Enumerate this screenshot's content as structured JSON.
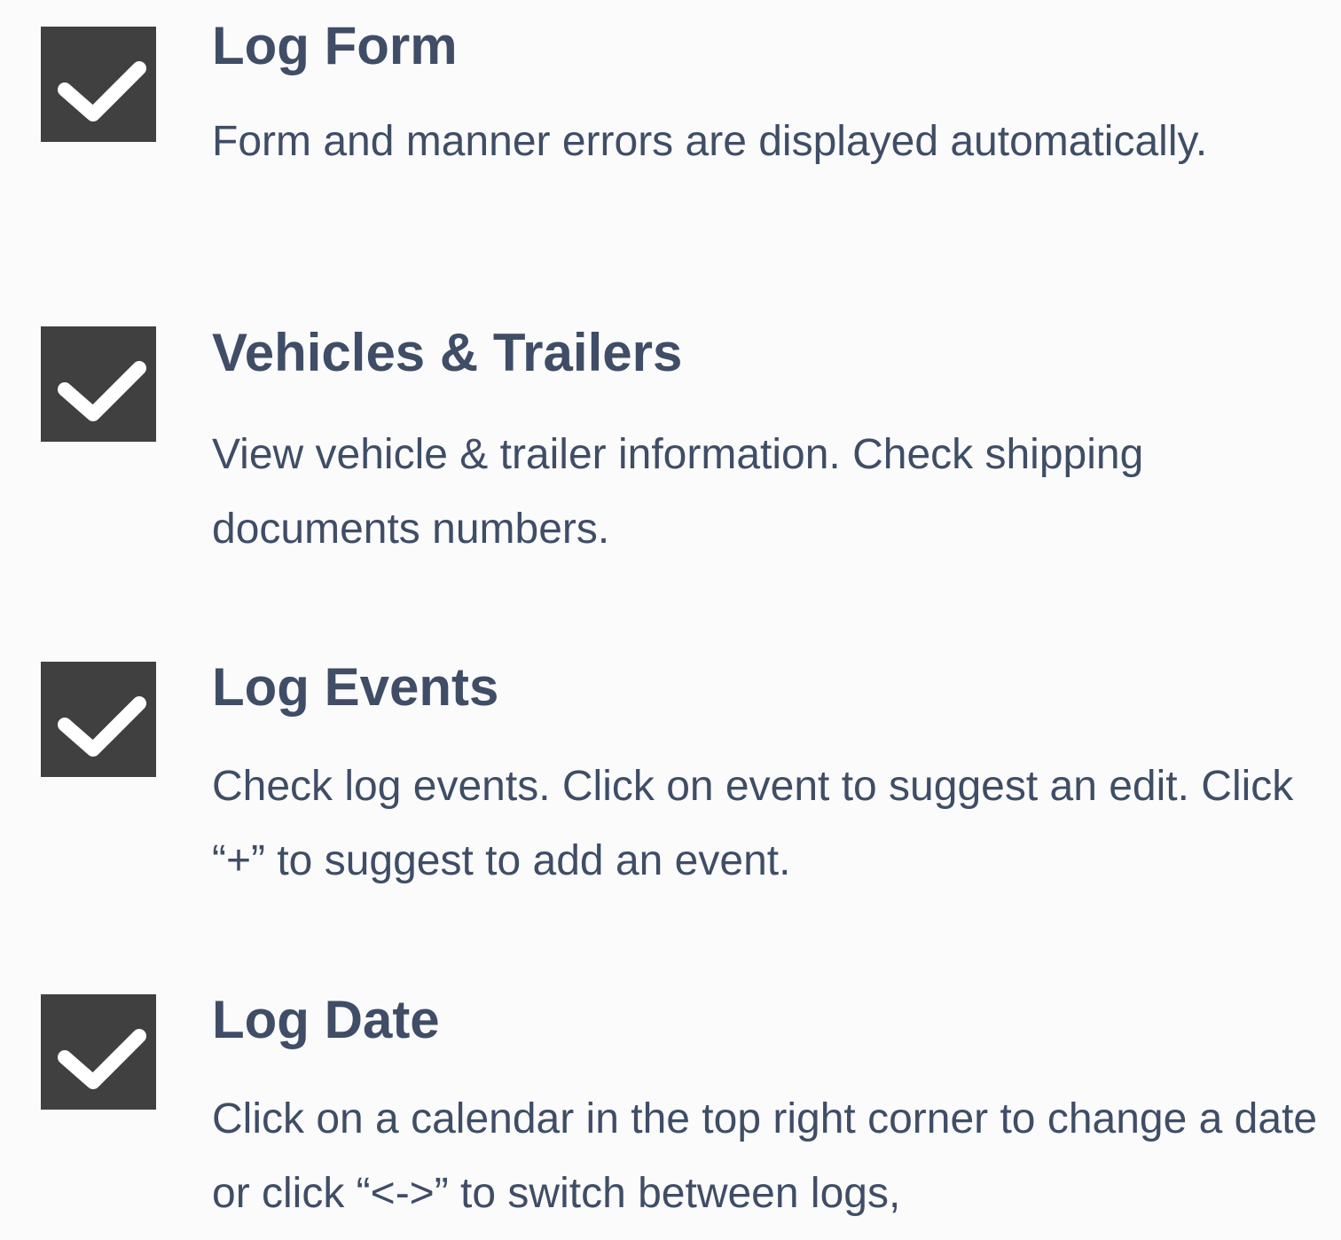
{
  "items": [
    {
      "icon": "checkbox-checked-icon",
      "title": "Log Form",
      "description": "Form and manner errors are displayed automatically."
    },
    {
      "icon": "checkbox-checked-icon",
      "title": "Vehicles & Trailers",
      "description": "View vehicle & trailer information. Check shipping documents numbers."
    },
    {
      "icon": "checkbox-checked-icon",
      "title": "Log Events",
      "description": "Check log events. Click on event to suggest an edit. Click “+” to suggest to add an event."
    },
    {
      "icon": "checkbox-checked-icon",
      "title": "Log Date",
      "description": "Click on a calendar in the top right corner to change a date or click “<->” to switch between logs,"
    }
  ],
  "colors": {
    "background": "#fbfbfc",
    "checkbox": "#404040",
    "text": "#3f4d66"
  }
}
